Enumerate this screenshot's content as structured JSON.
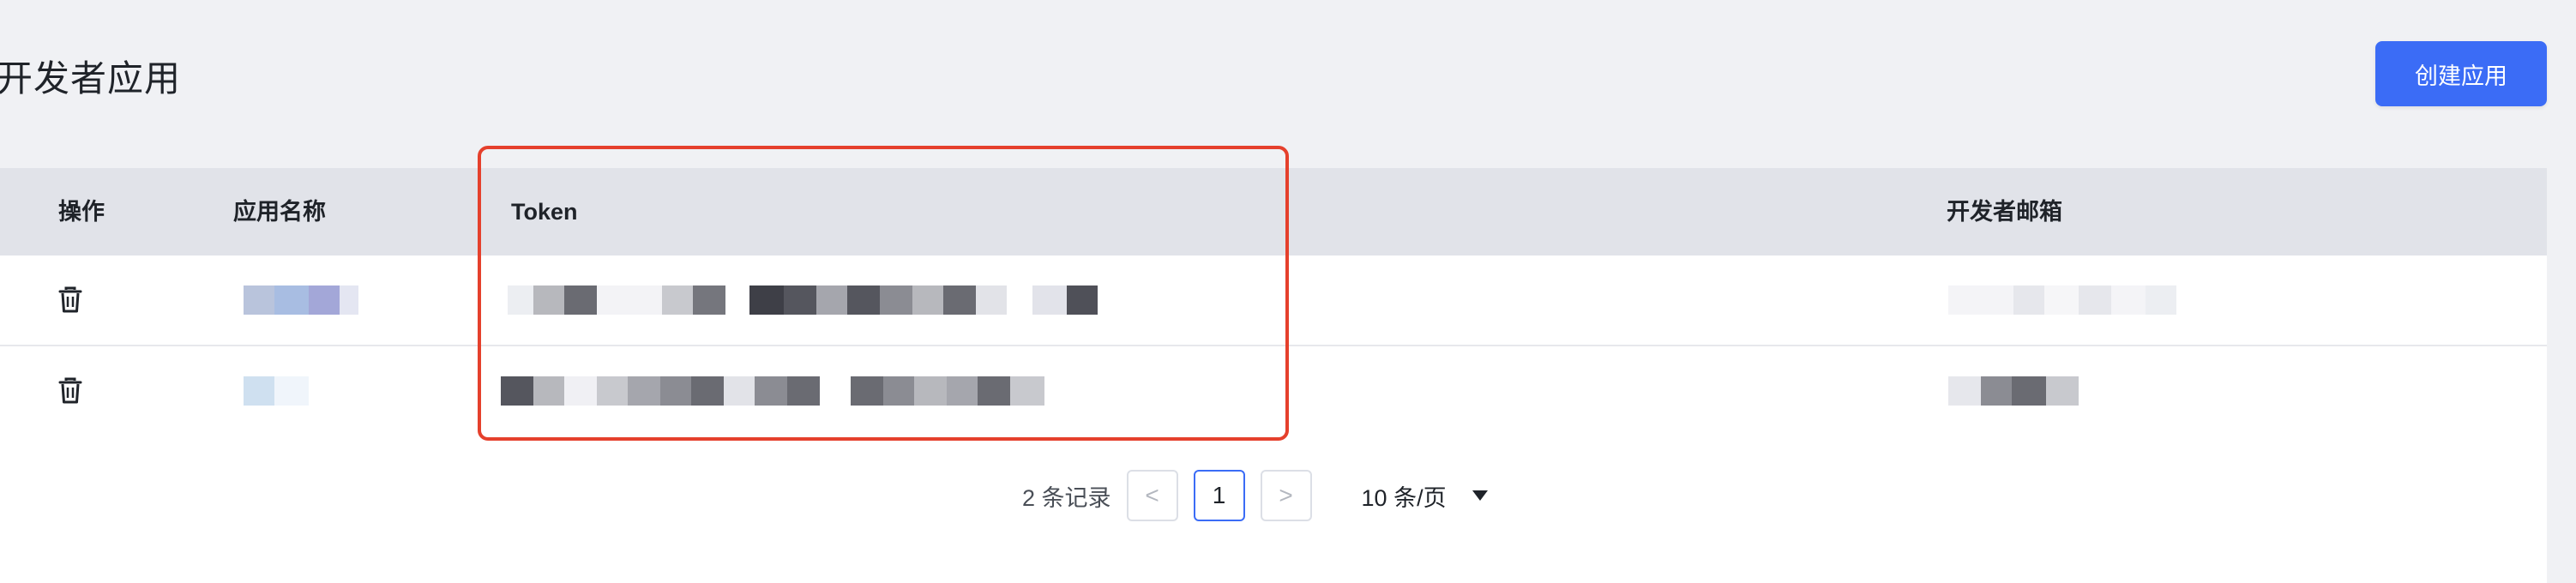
{
  "page": {
    "title": "开发者应用"
  },
  "toolbar": {
    "create_label": "创建应用",
    "accent": "#3b6cf6"
  },
  "table": {
    "columns": [
      "操作",
      "应用名称",
      "Token",
      "开发者邮箱"
    ],
    "rows": [
      {
        "action_icon": "trash-icon",
        "app_name": "",
        "token": "",
        "email": ""
      },
      {
        "action_icon": "trash-icon",
        "app_name": "",
        "token": "",
        "email": ""
      }
    ]
  },
  "highlight": {
    "color": "#e5402c"
  },
  "pagination": {
    "total_text": "2 条记录",
    "prev": "<",
    "current_page": "1",
    "next": ">",
    "page_size": "10 条/页"
  }
}
